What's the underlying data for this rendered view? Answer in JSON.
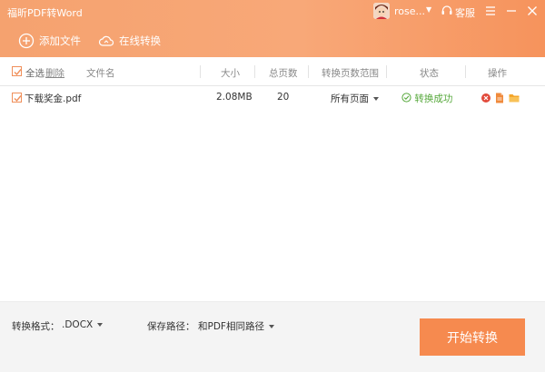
{
  "app": {
    "title": "福昕PDF转Word"
  },
  "user": {
    "name": "rose...",
    "support_label": "客服"
  },
  "toolbar": {
    "add_file": "添加文件",
    "online_convert": "在线转换"
  },
  "table": {
    "select_all": "全选",
    "delete": "删除",
    "columns": [
      "文件名",
      "大小",
      "总页数",
      "转换页数范围",
      "状态",
      "操作"
    ],
    "rows": [
      {
        "name": "下载奖金.pdf",
        "size": "2.08MB",
        "pages": "20",
        "range": "所有页面",
        "status": "转换成功"
      }
    ]
  },
  "bottom": {
    "format_label": "转换格式：",
    "format_value": ".DOCX",
    "path_label": "保存路径：",
    "path_value": "和PDF相同路径",
    "start_button": "开始转换"
  },
  "colors": {
    "accent": "#f68a4f",
    "success": "#56a83b",
    "delete": "#e24a3b",
    "word": "#f08a3c",
    "folder": "#f4a62a"
  }
}
